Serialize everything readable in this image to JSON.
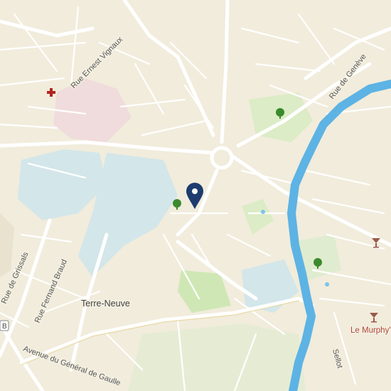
{
  "map": {
    "labels": {
      "rue_ernest_vignaux": "Rue Ernest Vignaux",
      "rue_de_geneve": "Rue de Genève",
      "rue_de_grissals": "Rue de Grissals",
      "rue_fernand_braud": "Rue Fernand Braud",
      "terre_neuve": "Terre-Neuve",
      "avenue_general_de_gaulle": "Avenue du Général de Gaulle",
      "le_murphys": "Le Murphy's",
      "route_b": "B",
      "sellot": "Sellot"
    },
    "colors": {
      "land": "#f1ecdc",
      "road": "#ffffff",
      "river": "#59b2e3",
      "park": "#d9ebc2",
      "hospital": "#f3dede",
      "school": "#cfe4ec",
      "marker": "#1d3b6f",
      "medical_cross": "#b3231f",
      "bar": "#9a5a48",
      "tree": "#3b8a2e"
    },
    "icons": [
      "medical-cross-icon",
      "location-pin-icon",
      "park-tree-icon",
      "bar-cocktail-icon"
    ]
  }
}
